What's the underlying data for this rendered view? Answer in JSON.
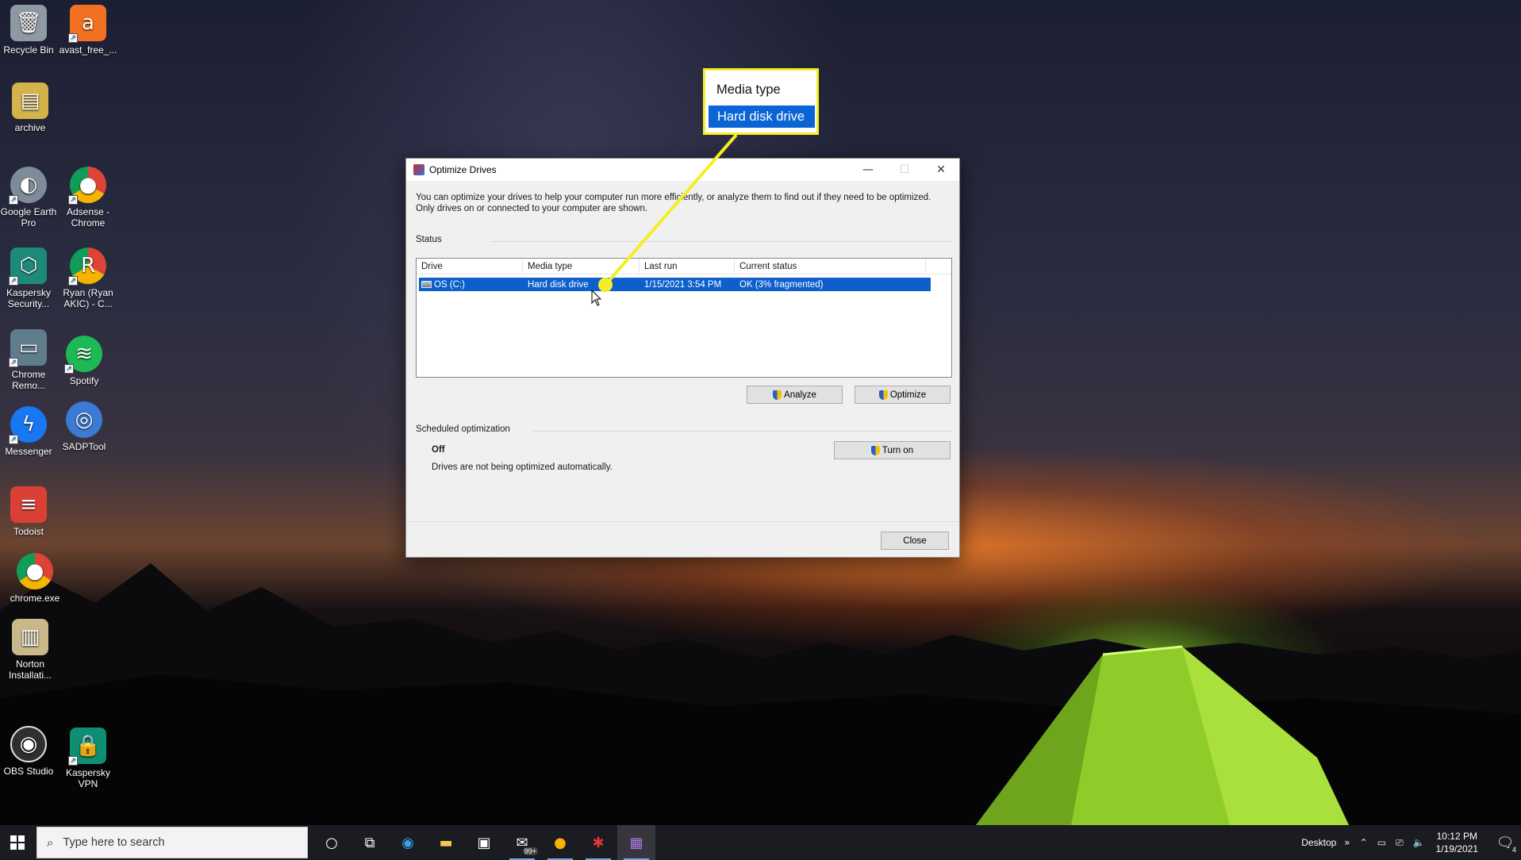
{
  "desktop_icons": [
    {
      "id": "recycle-bin",
      "label": "Recycle Bin",
      "icon": "recycle-bin-icon",
      "color": "#9aa4ad"
    },
    {
      "id": "avast",
      "label": "avast_free_...",
      "icon": "avast-icon",
      "color": "#f36f21"
    },
    {
      "id": "archive",
      "label": "archive",
      "icon": "archive-icon",
      "color": "#d6b24a"
    },
    {
      "id": "google-earth",
      "label": "Google Earth Pro",
      "icon": "google-earth-icon",
      "color": "#7e8b99"
    },
    {
      "id": "adsense-chrome",
      "label": "Adsense - Chrome",
      "icon": "chrome-icon",
      "color": "#2e7d32"
    },
    {
      "id": "kaspersky-security",
      "label": "Kaspersky Security...",
      "icon": "kaspersky-icon",
      "color": "#1f8a78"
    },
    {
      "id": "ryan-chrome",
      "label": "Ryan (Ryan AKIC) - C...",
      "icon": "chrome-profile-icon",
      "color": "#c62828"
    },
    {
      "id": "chrome-remote",
      "label": "Chrome Remo...",
      "icon": "chrome-remote-icon",
      "color": "#607d8b"
    },
    {
      "id": "spotify",
      "label": "Spotify",
      "icon": "spotify-icon",
      "color": "#1db954"
    },
    {
      "id": "messenger",
      "label": "Messenger",
      "icon": "messenger-icon",
      "color": "#1877f2"
    },
    {
      "id": "sadptool",
      "label": "SADPTool",
      "icon": "sadptool-icon",
      "color": "#3a7bd5"
    },
    {
      "id": "todoist",
      "label": "Todoist",
      "icon": "todoist-icon",
      "color": "#db4035"
    },
    {
      "id": "chrome-exe",
      "label": "chrome.exe",
      "icon": "chrome-icon",
      "color": "#fbbc05"
    },
    {
      "id": "norton",
      "label": "Norton Installati...",
      "icon": "norton-icon",
      "color": "#c9b98a"
    },
    {
      "id": "obs",
      "label": "OBS Studio",
      "icon": "obs-icon",
      "color": "#302e31"
    },
    {
      "id": "kaspersky-vpn",
      "label": "Kaspersky VPN",
      "icon": "kaspersky-vpn-icon",
      "color": "#0e8f74"
    }
  ],
  "callout": {
    "header": "Media type",
    "selected": "Hard disk drive",
    "border_color": "#f3ee27",
    "highlight_color": "#0a64d6"
  },
  "window": {
    "title": "Optimize Drives",
    "intro": "You can optimize your drives to help your computer run more efficiently, or analyze them to find out if they need to be optimized. Only drives on or connected to your computer are shown.",
    "status_label": "Status",
    "columns": [
      "Drive",
      "Media type",
      "Last run",
      "Current status"
    ],
    "rows": [
      {
        "drive": "OS (C:)",
        "media_type": "Hard disk drive",
        "last_run": "1/15/2021 3:54 PM",
        "current_status": "OK (3% fragmented)"
      }
    ],
    "analyze_label": "Analyze",
    "optimize_label": "Optimize",
    "scheduled_label": "Scheduled optimization",
    "schedule_state": "Off",
    "schedule_desc": "Drives are not being optimized automatically.",
    "turn_on_label": "Turn on",
    "close_label": "Close"
  },
  "taskbar": {
    "search_placeholder": "Type here to search",
    "mail_badge": "99+",
    "desktop_label": "Desktop",
    "time": "10:12 PM",
    "date": "1/19/2021",
    "notification_count": "4"
  }
}
